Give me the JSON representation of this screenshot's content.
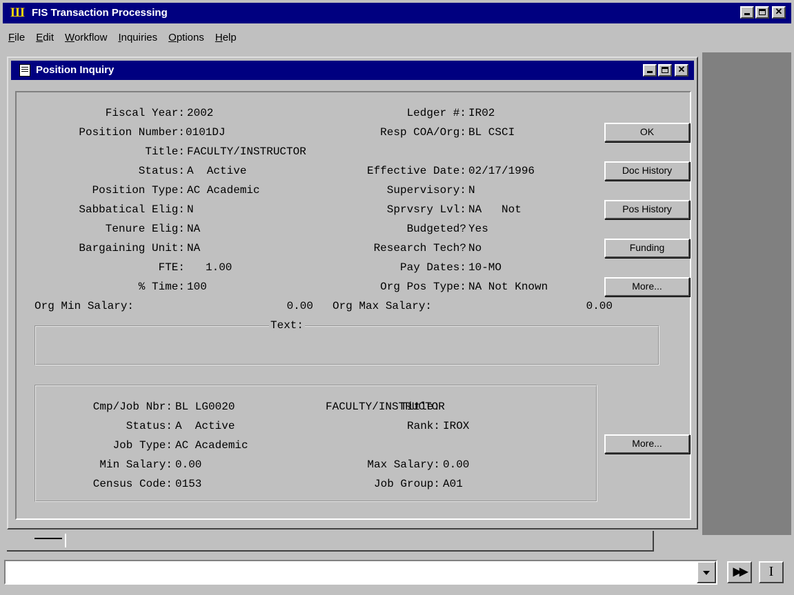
{
  "app": {
    "title": "FIS Transaction Processing",
    "icon": "IU-logo"
  },
  "menu": [
    {
      "label": "File",
      "u": "F",
      "rest": "ile"
    },
    {
      "label": "Edit",
      "u": "E",
      "rest": "dit"
    },
    {
      "label": "Workflow",
      "u": "W",
      "rest": "orkflow"
    },
    {
      "label": "Inquiries",
      "u": "I",
      "rest": "nquiries"
    },
    {
      "label": "Options",
      "u": "O",
      "rest": "ptions"
    },
    {
      "label": "Help",
      "u": "H",
      "rest": "elp"
    }
  ],
  "window": {
    "title": "Position Inquiry"
  },
  "position": {
    "fiscal_year_label": "Fiscal Year:",
    "fiscal_year": "2002",
    "ledger_label": "Ledger #:",
    "ledger": "IR02",
    "position_number_label": "Position Number:",
    "position_number": "0101DJ",
    "resp_coa_label": "Resp COA/Org:",
    "resp_coa": "BL CSCI",
    "title_label": "Title:",
    "title": "FACULTY/INSTRUCTOR",
    "status_label": "Status:",
    "status": "A  Active",
    "effective_date_label": "Effective Date:",
    "effective_date": "02/17/1996",
    "position_type_label": "Position Type:",
    "position_type": "AC Academic",
    "supervisory_label": "Supervisory:",
    "supervisory": "N",
    "sabbatical_label": "Sabbatical Elig:",
    "sabbatical": "N",
    "sprvsry_lvl_label": "Sprvsry Lvl:",
    "sprvsry_lvl": "NA   Not",
    "tenure_label": "Tenure Elig:",
    "tenure": "NA",
    "budgeted_label": "Budgeted?",
    "budgeted": "Yes",
    "bargaining_label": "Bargaining Unit:",
    "bargaining": "NA",
    "research_tech_label": "Research Tech?",
    "research_tech": "No",
    "fte_label": "FTE:",
    "fte": "1.00",
    "pay_dates_label": "Pay Dates:",
    "pay_dates": "10-MO",
    "time_label": "% Time:",
    "time": "100",
    "org_pos_type_label": "Org Pos Type:",
    "org_pos_type": "NA Not Known",
    "org_min_salary_label": "Org Min Salary:",
    "org_min_salary": "0.00",
    "org_max_salary_label": "Org Max Salary:",
    "org_max_salary": "0.00",
    "text_label": "Text:"
  },
  "job": {
    "cmp_job_label": "Cmp/Job Nbr:",
    "cmp_job": "BL LG0020",
    "title_label": "Title:",
    "title": "FACULTY/INSTRUCTOR",
    "status_label": "Status:",
    "status": "A  Active",
    "rank_label": "Rank:",
    "rank": "IROX",
    "job_type_label": "Job Type:",
    "job_type": "AC Academic",
    "min_salary_label": "Min Salary:",
    "min_salary": "0.00",
    "max_salary_label": "Max Salary:",
    "max_salary": "0.00",
    "census_label": "Census Code:",
    "census": "0153",
    "job_group_label": "Job Group:",
    "job_group": "A01"
  },
  "buttons": {
    "ok": "OK",
    "doc_history": "Doc History",
    "pos_history": "Pos History",
    "funding": "Funding",
    "more1": "More...",
    "more2": "More..."
  },
  "toolbar": {
    "dropdown_icon": "chevron-down-icon",
    "forward_icon": "fast-forward-icon",
    "text_cursor_icon": "i-beam-icon"
  }
}
